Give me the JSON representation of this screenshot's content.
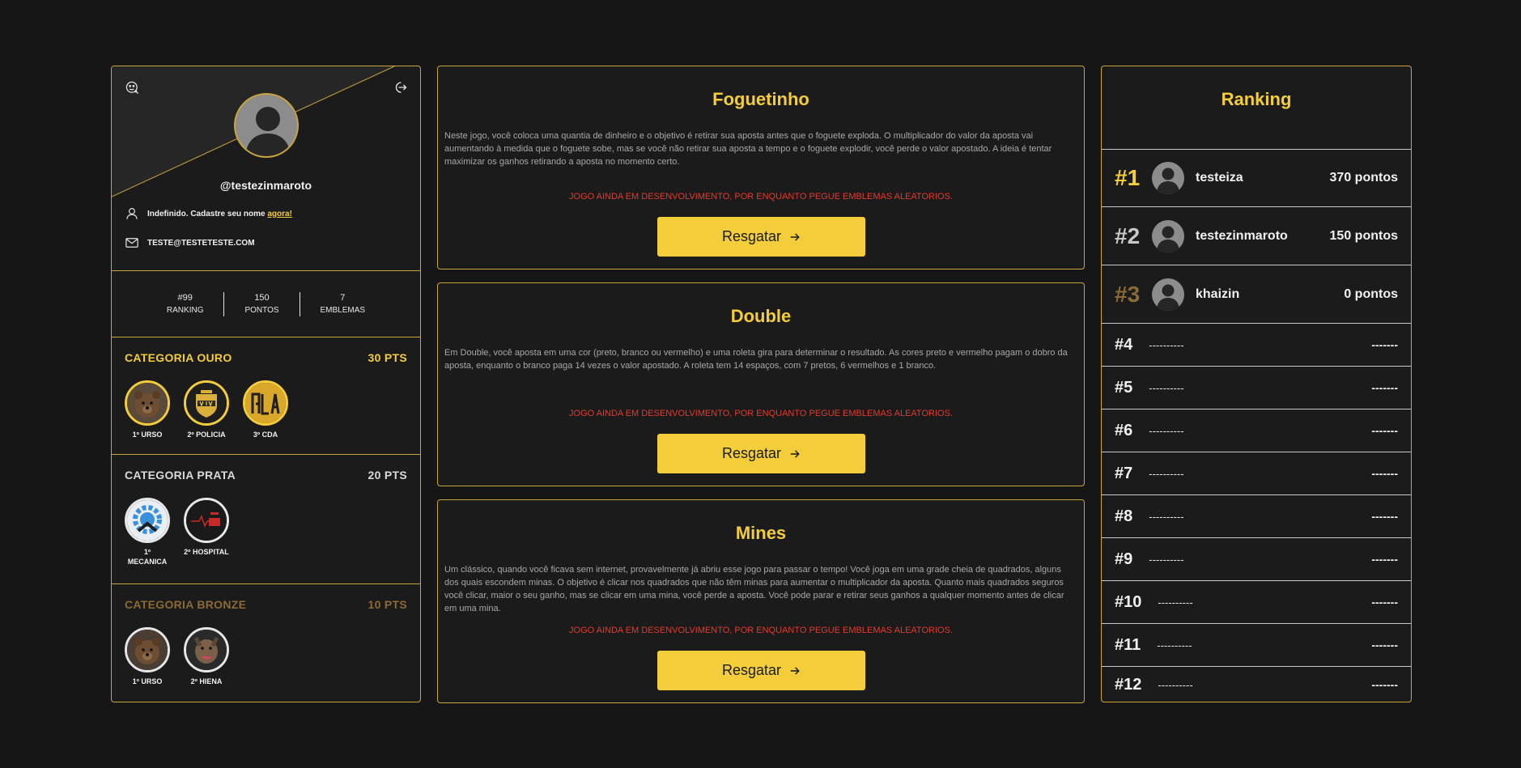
{
  "profile": {
    "username": "@testezinmaroto",
    "name_notice": "Indefinido. Cadastre seu nome ",
    "name_link": "agora!",
    "email": "TESTE@TESTETESTE.COM",
    "stats": [
      {
        "value": "#99",
        "label": "RANKING"
      },
      {
        "value": "150",
        "label": "PONTOS"
      },
      {
        "value": "7",
        "label": "EMBLEMAS"
      }
    ],
    "categories": [
      {
        "title": "CATEGORIA OURO",
        "points": "30 PTS",
        "color": "#f3cd3a",
        "badges": [
          {
            "label": "1º URSO"
          },
          {
            "label": "2º POLICIA"
          },
          {
            "label": "3º CDA"
          }
        ]
      },
      {
        "title": "CATEGORIA PRATA",
        "points": "20 PTS",
        "color": "#d9d9d9",
        "badges": [
          {
            "label": "1º MECANICA"
          },
          {
            "label": "2º HOSPITAL"
          }
        ]
      },
      {
        "title": "CATEGORIA BRONZE",
        "points": "10 PTS",
        "color": "#8a6a35",
        "badges": [
          {
            "label": "1º URSO"
          },
          {
            "label": "2º HIENA"
          }
        ]
      }
    ]
  },
  "games": [
    {
      "title": "Foguetinho",
      "description": "Neste jogo, você coloca uma quantia de dinheiro e o objetivo é retirar sua aposta antes que o foguete exploda. O multiplicador do valor da aposta vai aumentando à medida que o foguete sobe, mas se você não retirar sua aposta a tempo e o foguete explodir, você perde o valor apostado. A ideia é tentar maximizar os ganhos retirando a aposta no momento certo.",
      "warning": "JOGO AINDA EM DESENVOLVIMENTO, POR ENQUANTO PEGUE EMBLEMAS ALEATORIOS.",
      "button": "Resgatar"
    },
    {
      "title": "Double",
      "description": "Em Double, você aposta em uma cor (preto, branco ou vermelho) e uma roleta gira para determinar o resultado. As cores preto e vermelho pagam o dobro da aposta, enquanto o branco paga 14 vezes o valor apostado. A roleta tem 14 espaços, com 7 pretos, 6 vermelhos e 1 branco.",
      "warning": "JOGO AINDA EM DESENVOLVIMENTO, POR ENQUANTO PEGUE EMBLEMAS ALEATORIOS.",
      "button": "Resgatar"
    },
    {
      "title": "Mines",
      "description": "Um clássico, quando você ficava sem internet, provavelmente já abriu esse jogo para passar o tempo! Você joga em uma grade cheia de quadrados, alguns dos quais escondem minas. O objetivo é clicar nos quadrados que não têm minas para aumentar o multiplicador da aposta. Quanto mais quadrados seguros você clicar, maior o seu ganho, mas se clicar em uma mina, você perde a aposta. Você pode parar e retirar seus ganhos a qualquer momento antes de clicar em uma mina.",
      "warning": "JOGO AINDA EM DESENVOLVIMENTO, POR ENQUANTO PEGUE EMBLEMAS ALEATORIOS.",
      "button": "Resgatar"
    }
  ],
  "ranking": {
    "title": "Ranking",
    "top": [
      {
        "pos": "#1",
        "name": "testeiza",
        "points": "370 pontos",
        "color": "#f3cd3a"
      },
      {
        "pos": "#2",
        "name": "testezinmaroto",
        "points": "150 pontos",
        "color": "#c8c8c8"
      },
      {
        "pos": "#3",
        "name": "khaizin",
        "points": "0 pontos",
        "color": "#8a6a35"
      }
    ],
    "rest": [
      {
        "pos": "#4",
        "name": "----------",
        "points": "-------"
      },
      {
        "pos": "#5",
        "name": "----------",
        "points": "-------"
      },
      {
        "pos": "#6",
        "name": "----------",
        "points": "-------"
      },
      {
        "pos": "#7",
        "name": "----------",
        "points": "-------"
      },
      {
        "pos": "#8",
        "name": "----------",
        "points": "-------"
      },
      {
        "pos": "#9",
        "name": "----------",
        "points": "-------"
      },
      {
        "pos": "#10",
        "name": "----------",
        "points": "-------"
      },
      {
        "pos": "#11",
        "name": "----------",
        "points": "-------"
      },
      {
        "pos": "#12",
        "name": "----------",
        "points": "-------"
      }
    ]
  }
}
